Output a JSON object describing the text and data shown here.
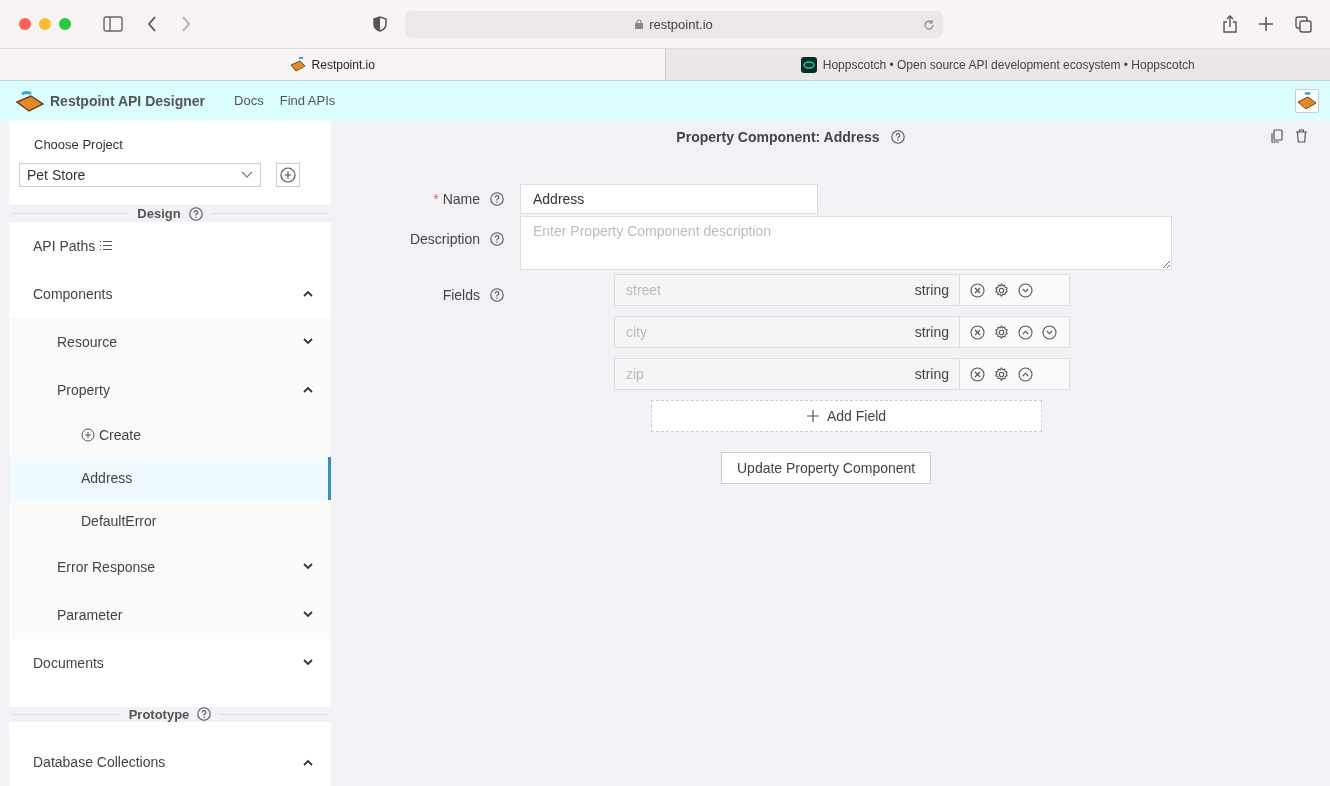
{
  "browser": {
    "url": "restpoint.io",
    "tabs": [
      {
        "title": "Restpoint.io",
        "selected": true,
        "kind": "restpoint"
      },
      {
        "title": "Hoppscotch • Open source API development ecosystem • Hoppscotch",
        "selected": false,
        "kind": "hoppscotch"
      }
    ]
  },
  "app_header": {
    "brand": "Restpoint API Designer",
    "nav": [
      "Docs",
      "Find APIs"
    ]
  },
  "sidebar": {
    "project_label": "Choose Project",
    "project": "Pet Store",
    "design_heading": "Design",
    "design_items": [
      {
        "label": "API Paths",
        "kind": "paths",
        "selected": false
      },
      {
        "label": "Components",
        "kind": "group",
        "expanded": true,
        "selected": false,
        "children": [
          {
            "label": "Resource",
            "kind": "group",
            "expanded": false,
            "selected": false
          },
          {
            "label": "Property",
            "kind": "group",
            "expanded": true,
            "selected": false,
            "children": [
              {
                "label": "Create",
                "kind": "create",
                "selected": false
              },
              {
                "label": "Address",
                "kind": "leaf",
                "selected": true
              },
              {
                "label": "DefaultError",
                "kind": "leaf",
                "selected": false
              }
            ]
          },
          {
            "label": "Error Response",
            "kind": "group",
            "expanded": false,
            "selected": false
          },
          {
            "label": "Parameter",
            "kind": "group",
            "expanded": false,
            "selected": false
          }
        ]
      },
      {
        "label": "Documents",
        "kind": "group",
        "expanded": false,
        "selected": false
      }
    ],
    "prototype_heading": "Prototype",
    "prototype_items": [
      {
        "label": "Database Collections",
        "kind": "group",
        "expanded": true,
        "selected": false
      }
    ]
  },
  "main": {
    "title": "Property Component: Address",
    "name_label": "Name",
    "name_required_mark": "*",
    "name_value": "Address",
    "description_label": "Description",
    "description_placeholder": "Enter Property Component description",
    "fields_label": "Fields",
    "fields": [
      {
        "name": "street",
        "type": "string",
        "can_move_up": false,
        "can_move_down": true
      },
      {
        "name": "city",
        "type": "string",
        "can_move_up": true,
        "can_move_down": true
      },
      {
        "name": "zip",
        "type": "string",
        "can_move_up": true,
        "can_move_down": false
      }
    ],
    "add_field": "Add Field",
    "submit": "Update Property Component"
  }
}
